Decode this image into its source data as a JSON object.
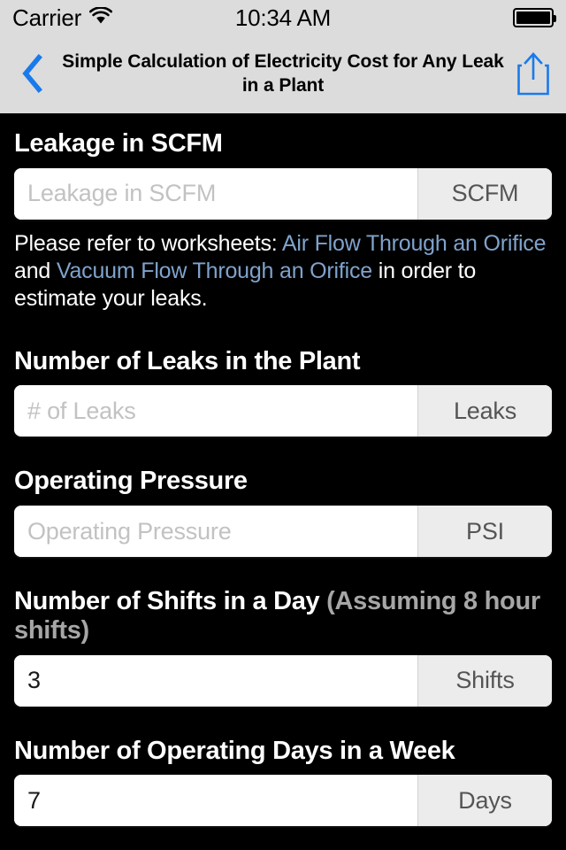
{
  "status_bar": {
    "carrier": "Carrier",
    "wifi_icon": "wifi-icon",
    "time": "10:34 AM",
    "battery_icon": "battery-full-icon"
  },
  "nav_bar": {
    "back_icon": "chevron-left-icon",
    "title": "Simple Calculation of Electricity Cost for Any Leak in a Plant",
    "share_icon": "share-icon",
    "accent_color": "#1a7aeb",
    "background_color": "#dcdcdc"
  },
  "theme": {
    "background": "#000000",
    "heading_color": "#ffffff",
    "heading_sub_color": "#a6a6a6",
    "link_color": "#7fa3cc",
    "unit_background": "#ececec",
    "unit_text": "#555555",
    "placeholder_color": "#c2c2c2"
  },
  "fields": [
    {
      "label": "Leakage in SCFM",
      "label_sub": "",
      "value": "",
      "placeholder": "Leakage in SCFM",
      "unit": "SCFM"
    },
    {
      "label": "Number of Leaks in the Plant",
      "label_sub": "",
      "value": "",
      "placeholder": "# of Leaks",
      "unit": "Leaks"
    },
    {
      "label": "Operating Pressure",
      "label_sub": "",
      "value": "",
      "placeholder": "Operating Pressure",
      "unit": "PSI"
    },
    {
      "label": "Number of Shifts in a Day ",
      "label_sub": "(Assuming 8 hour shifts)",
      "value": "3",
      "placeholder": "",
      "unit": "Shifts"
    },
    {
      "label": "Number of Operating Days in a Week",
      "label_sub": "",
      "value": "7",
      "placeholder": "",
      "unit": "Days"
    }
  ],
  "helper": {
    "prefix": "Please refer to worksheets: ",
    "link1": "Air Flow Through an Orifice",
    "middle": " and ",
    "link2": "Vacuum Flow Through an Orifice",
    "suffix": " in order to estimate your leaks."
  }
}
